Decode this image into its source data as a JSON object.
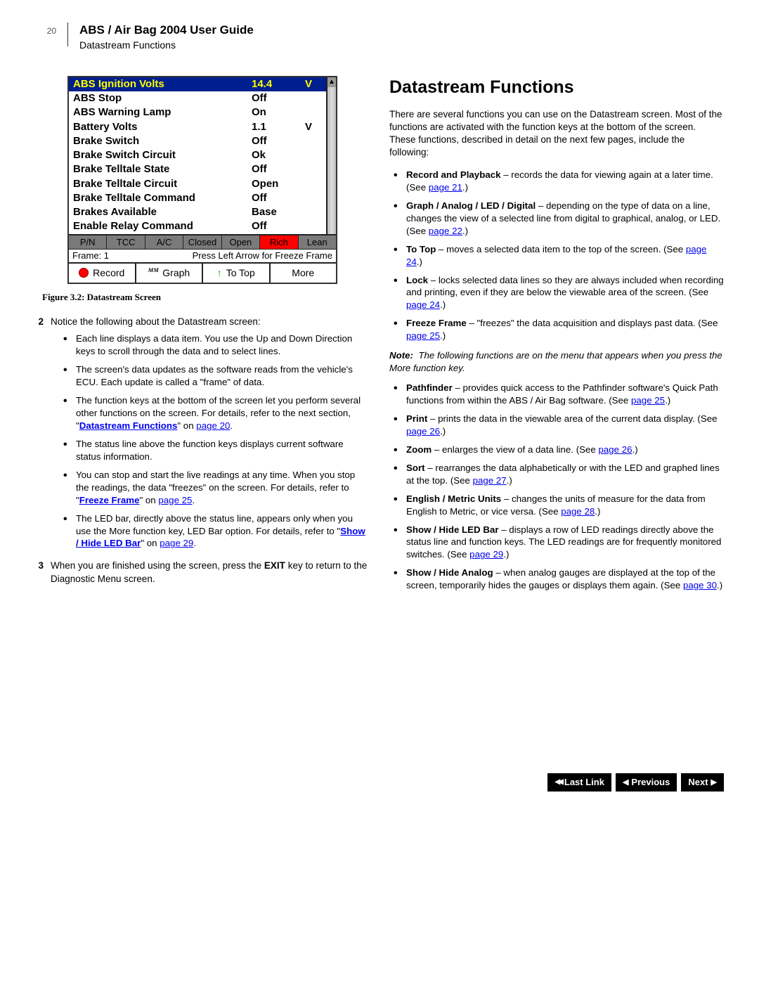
{
  "header": {
    "page_number": "20",
    "title": "ABS / Air Bag 2004 User Guide",
    "subtitle": "Datastream Functions"
  },
  "screenshot": {
    "rows": [
      {
        "label": "ABS Ignition Volts",
        "value": "14.4",
        "unit": "V",
        "highlight": true
      },
      {
        "label": "ABS Stop",
        "value": "Off",
        "unit": ""
      },
      {
        "label": "ABS Warning Lamp",
        "value": "On",
        "unit": ""
      },
      {
        "label": "Battery Volts",
        "value": "1.1",
        "unit": "V"
      },
      {
        "label": "Brake Switch",
        "value": "Off",
        "unit": ""
      },
      {
        "label": "Brake Switch Circuit",
        "value": "Ok",
        "unit": ""
      },
      {
        "label": "Brake Telltale State",
        "value": "Off",
        "unit": ""
      },
      {
        "label": "Brake Telltale Circuit",
        "value": "Open",
        "unit": ""
      },
      {
        "label": "Brake Telltale Command",
        "value": "Off",
        "unit": ""
      },
      {
        "label": "Brakes Available",
        "value": "Base",
        "unit": ""
      },
      {
        "label": "Enable Relay Command",
        "value": "Off",
        "unit": ""
      }
    ],
    "led_bar": [
      "P/N",
      "TCC",
      "A/C",
      "Closed",
      "Open",
      "Rich",
      "Lean"
    ],
    "led_on_index": 5,
    "status_left": "Frame: 1",
    "status_right": "Press Left Arrow for Freeze Frame",
    "fn_keys": {
      "record": "Record",
      "graph": "Graph",
      "totop": "To Top",
      "more": "More"
    }
  },
  "figure_caption": "Figure 3.2: Datastream Screen",
  "left": {
    "item2_intro": "Notice the following about the Datastream screen:",
    "bullets2": [
      "Each line displays a data item. You use the Up and Down Direction keys to scroll through the data and to select lines.",
      "The screen's data updates as the software reads from the vehicle's ECU. Each update is called a \"frame\" of data.",
      {
        "pre": "The function keys at the bottom of the screen let you perform several other functions on the screen. For details, refer to the next section, \"",
        "link": "Datastream Functions",
        "post": "\" on ",
        "link2": "page 20",
        "tail": "."
      },
      "The status line above the function keys displays current software status information.",
      {
        "pre": "You can stop and start the live readings at any time. When you stop the readings, the data \"freezes\" on the screen. For details, refer to \"",
        "link": "Freeze Frame",
        "post": "\" on ",
        "link2": "page 25",
        "tail": "."
      },
      {
        "pre": "The LED bar, directly above the status line, appears only when you use the More function key, LED Bar option. For details, refer to \"",
        "link": "Show / Hide LED Bar",
        "post": "\" on ",
        "link2": "page 29",
        "tail": "."
      }
    ],
    "item3": {
      "n": "3",
      "text_pre": "When you are finished using the screen, press the ",
      "bold": "EXIT",
      "text_post": " key to return to the Diagnostic Menu screen."
    }
  },
  "right": {
    "heading": "Datastream Functions",
    "intro": "There are several functions you can use on the Datastream screen. Most of the functions are activated with the function keys at the bottom of the screen. These functions, described in detail on the next few pages, include the following:",
    "funcs1": [
      {
        "name": "Record and Playback",
        "desc": " – records the data for viewing again at a later time. (See ",
        "link": "page 21",
        "post": ".)"
      },
      {
        "name": "Graph / Analog / LED / Digital",
        "desc": " – depending on the type of data on a line, changes the view of a selected line from digital to graphical, analog, or LED. (See ",
        "link": "page 22",
        "post": ".)"
      },
      {
        "name": "To Top",
        "desc": " – moves a selected data item to the top of the screen. (See ",
        "link": "page 24",
        "post": ".)"
      },
      {
        "name": "Lock",
        "desc": " – locks selected data lines so they are always included when recording and printing, even if they are below the viewable area of the screen. (See ",
        "link": "page 24",
        "post": ".)"
      },
      {
        "name": "Freeze Frame",
        "desc": " – \"freezes\" the data acquisition and displays past data. (See ",
        "link": "page 25",
        "post": ".)"
      }
    ],
    "note": "The following functions are on the menu that appears when you press the More function key.",
    "funcs2": [
      {
        "name": "Pathfinder",
        "desc": " – provides quick access to the Pathfinder software's Quick Path functions from within the ABS / Air Bag software. (See ",
        "link": "page 25",
        "post": ".)"
      },
      {
        "name": "Print",
        "desc": " – prints the data in the viewable area of the current data display. (See ",
        "link": "page 26",
        "post": ".)"
      },
      {
        "name": "Zoom",
        "desc": " – enlarges the view of a data line. (See ",
        "link": "page 26",
        "post": ".)"
      },
      {
        "name": "Sort",
        "desc": " – rearranges the data alphabetically or with the LED and graphed lines at the top. (See ",
        "link": "page 27",
        "post": ".)"
      },
      {
        "name": "English / Metric Units",
        "desc": " – changes the units of measure for the data from English to Metric, or vice versa. (See ",
        "link": "page 28",
        "post": ".)"
      },
      {
        "name": "Show / Hide LED Bar",
        "desc": " – displays a row of LED readings directly above the status line and function keys. The LED readings are for frequently monitored switches. (See ",
        "link": "page 29",
        "post": ".)"
      },
      {
        "name": "Show / Hide Analog",
        "desc": " – when analog gauges are displayed at the top of the screen, temporarily hides the gauges or displays them again. (See ",
        "link": "page 30",
        "post": ".)"
      }
    ]
  },
  "footer": {
    "last": "Last Link",
    "prev": "Previous",
    "next": "Next"
  }
}
